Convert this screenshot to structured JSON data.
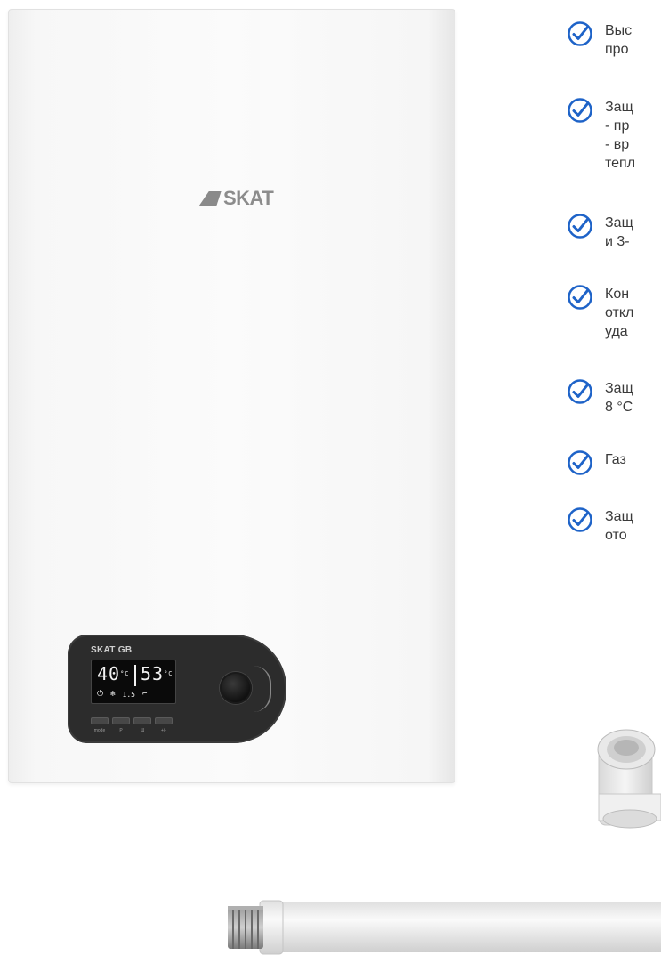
{
  "product": {
    "brand_logo": "SKAT",
    "panel_model": "SKAT GB",
    "display": {
      "left_value": "40",
      "left_unit": "°C",
      "right_value": "53",
      "right_unit": "°C",
      "pressure": "1.5"
    },
    "key_labels": [
      "mode",
      "P",
      "Ш",
      "+/-"
    ]
  },
  "features": [
    {
      "lines": [
        "Выс",
        "про"
      ]
    },
    {
      "lines": [
        "Защ",
        "- пр",
        "- вр",
        "тепл"
      ]
    },
    {
      "lines": [
        "Защ",
        "и 3-"
      ]
    },
    {
      "lines": [
        "Кон",
        "откл",
        "уда"
      ]
    },
    {
      "lines": [
        "Защ",
        "8 °С"
      ]
    },
    {
      "lines": [
        "Газ"
      ]
    },
    {
      "lines": [
        "Защ",
        "ото"
      ]
    }
  ],
  "colors": {
    "check_accent": "#1e63c8",
    "text": "#3a3a3a"
  },
  "icons": [
    "check-circle-icon",
    "knob-icon",
    "power-icon",
    "snowflake-icon",
    "faucet-icon"
  ]
}
